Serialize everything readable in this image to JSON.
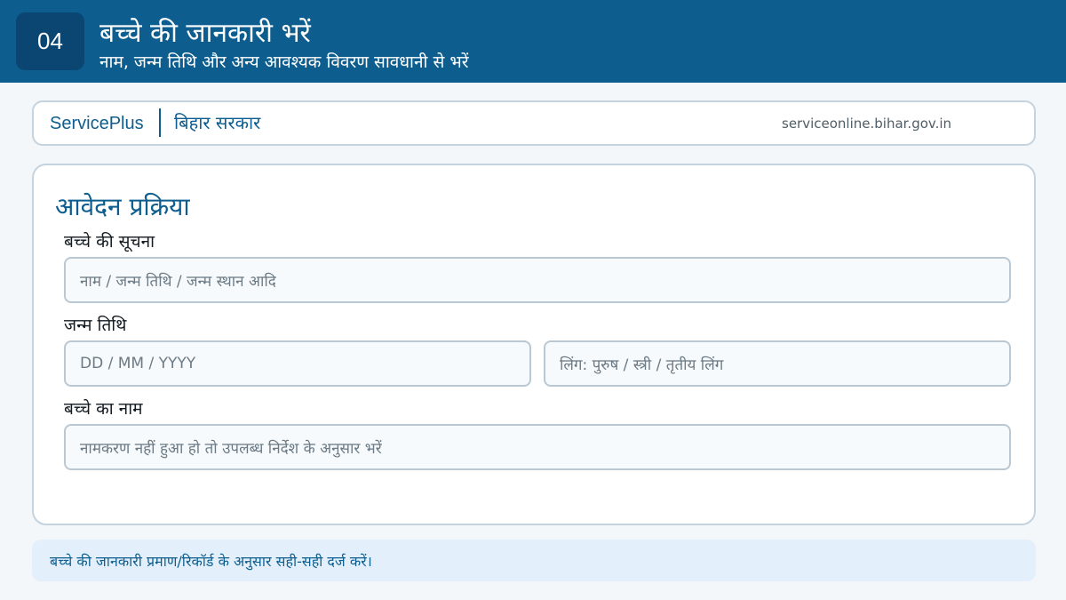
{
  "header": {
    "step_number": "04",
    "title": "बच्चे की जानकारी भरें",
    "subtitle": "नाम, जन्म तिथि और अन्य आवश्यक विवरण सावधानी से भरें"
  },
  "brand": {
    "name": "ServicePlus",
    "org": "बिहार सरकार",
    "url": "serviceonline.bihar.gov.in"
  },
  "form": {
    "title": "आवेदन प्रक्रिया",
    "fields": [
      {
        "label": "बच्चे की सूचना",
        "placeholder": "नाम / जन्म तिथि / जन्म स्थान आदि"
      },
      {
        "label": "जन्म तिथि",
        "placeholder": "DD / MM / YYYY",
        "secondary_placeholder": "लिंग: पुरुष / स्त्री / तृतीय लिंग"
      },
      {
        "label": "बच्चे का नाम",
        "placeholder": "नामकरण नहीं हुआ हो तो उपलब्ध निर्देश के अनुसार भरें"
      }
    ]
  },
  "note": "बच्चे की जानकारी प्रमाण/रिकॉर्ड के अनुसार सही-सही दर्ज करें।",
  "colors": {
    "primary": "#0d5e8f",
    "badge": "#0b4672",
    "note_bg": "#e3f0fb"
  }
}
